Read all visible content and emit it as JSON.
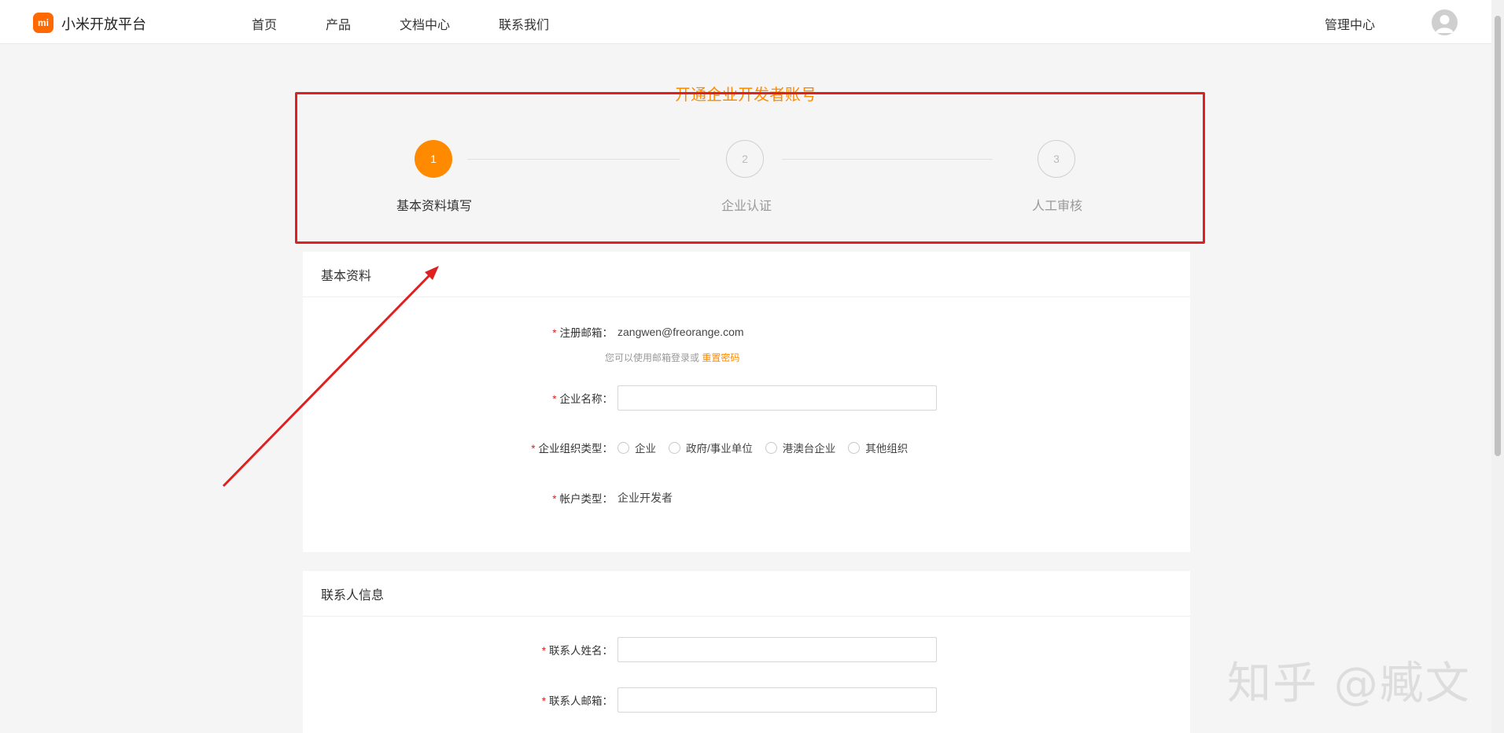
{
  "header": {
    "logo_text": "mi",
    "brand": "小米开放平台",
    "nav": [
      "首页",
      "产品",
      "文档中心",
      "联系我们"
    ],
    "admin": "管理中心"
  },
  "page": {
    "title": "开通企业开发者账号"
  },
  "steps": [
    {
      "number": "1",
      "label": "基本资料填写",
      "state": "active"
    },
    {
      "number": "2",
      "label": "企业认证",
      "state": "inactive"
    },
    {
      "number": "3",
      "label": "人工审核",
      "state": "inactive"
    }
  ],
  "basic_info": {
    "heading": "基本资料",
    "email_label": "注册邮箱：",
    "email_value": "zangwen@freorange.com",
    "email_hint": "您可以使用邮箱登录或",
    "email_hint_link": "重置密码",
    "company_name_label": "企业名称：",
    "org_type_label": "企业组织类型：",
    "org_types": [
      "企业",
      "政府/事业单位",
      "港澳台企业",
      "其他组织"
    ],
    "account_type_label": "帐户类型：",
    "account_type_value": "企业开发者"
  },
  "contact_info": {
    "heading": "联系人信息",
    "name_label": "联系人姓名：",
    "email_label": "联系人邮箱："
  },
  "colors": {
    "accent": "#ff8a00",
    "highlight": "#e02020"
  },
  "watermark": "知乎 @臧文"
}
